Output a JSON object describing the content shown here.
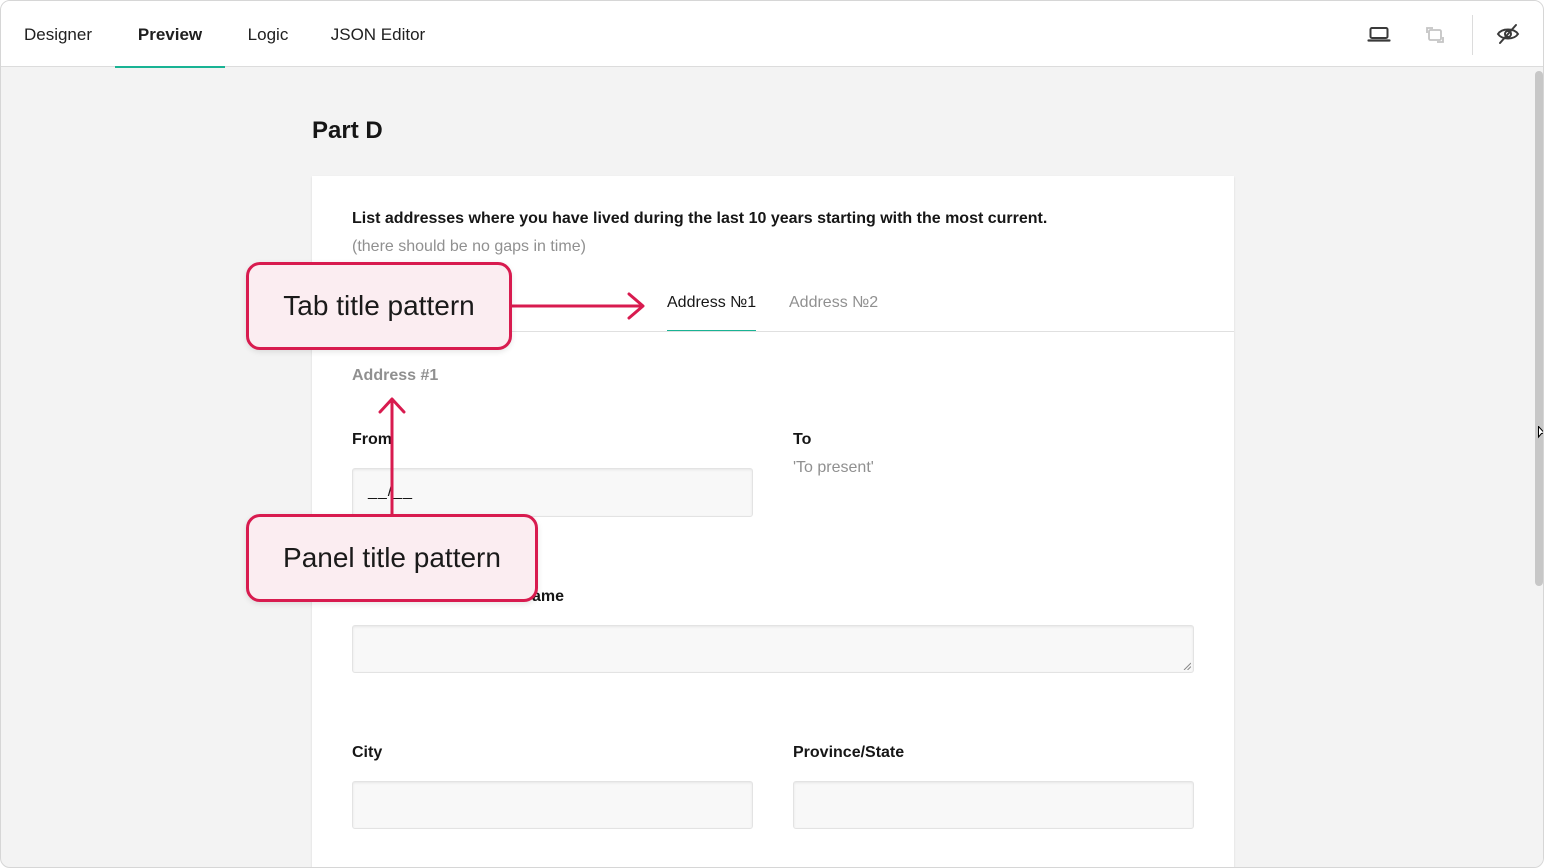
{
  "toolbar": {
    "tabs": [
      {
        "label": "Designer",
        "active": false
      },
      {
        "label": "Preview",
        "active": true
      },
      {
        "label": "Logic",
        "active": false
      },
      {
        "label": "JSON Editor",
        "active": false
      }
    ],
    "icons": [
      "laptop-icon",
      "orientation-icon",
      "hide-invisible-icon"
    ]
  },
  "page": {
    "title": "Part D"
  },
  "question": {
    "title": "List addresses where you have lived during the last 10 years starting with the most current.",
    "description": "(there should be no gaps in time)",
    "tabs": [
      {
        "label": "Address №1",
        "active": true
      },
      {
        "label": "Address №2",
        "active": false
      }
    ],
    "panel_title": "Address #1",
    "fields": {
      "from_label": "From",
      "from_mask": "__/__",
      "to_label": "To",
      "to_value": "'To present'",
      "street_label_visible": "ame",
      "city_label": "City",
      "province_label": "Province/State"
    }
  },
  "annotations": {
    "tab_callout": "Tab title pattern",
    "panel_callout": "Panel title pattern"
  },
  "colors": {
    "accent": "#19b394",
    "callout_border": "#d81b4f",
    "callout_fill": "#fbedf1"
  }
}
